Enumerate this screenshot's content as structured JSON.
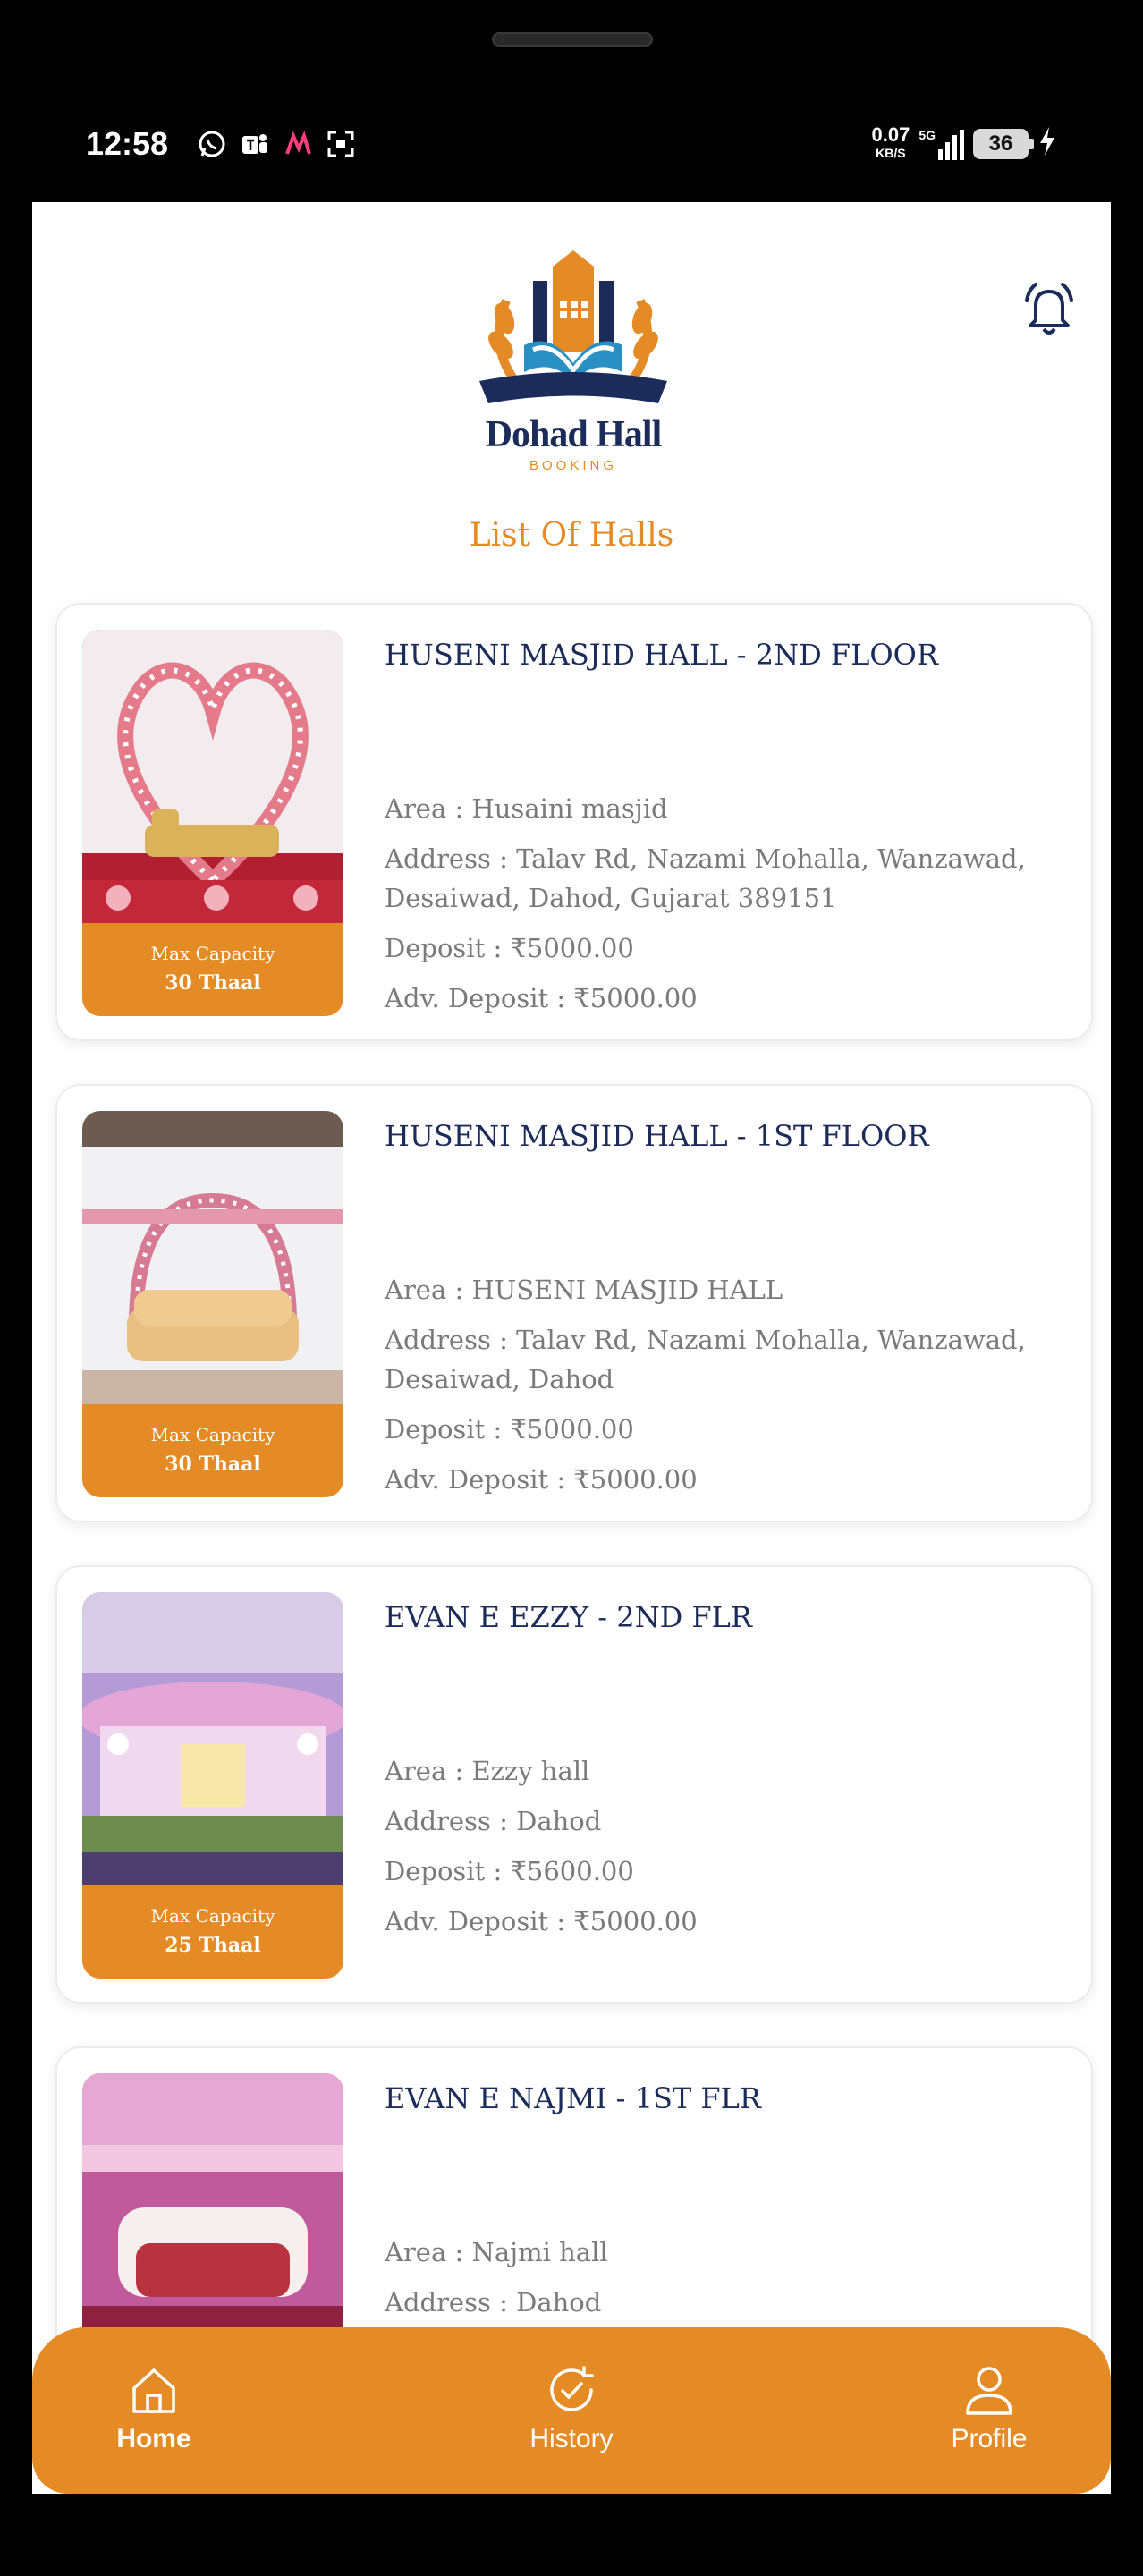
{
  "status_bar": {
    "time": "12:58",
    "net_speed": "0.07",
    "net_unit": "KB/S",
    "signal": "5G",
    "battery": "36"
  },
  "header": {
    "logo_text": "Dohad Hall",
    "logo_sub": "BOOKING",
    "page_title": "List Of Halls"
  },
  "halls": [
    {
      "name": "HUSENI MASJID HALL - 2ND FLOOR",
      "area": "Area : Husaini masjid",
      "address": "Address : Talav Rd, Nazami Mohalla, Wanzawad, Desaiwad, Dahod, Gujarat 389151",
      "deposit": "Deposit : ₹5000.00",
      "adv_deposit": "Adv. Deposit : ₹5000.00",
      "capacity_label": "Max Capacity",
      "capacity_value": "30 Thaal"
    },
    {
      "name": "HUSENI MASJID HALL - 1ST FLOOR",
      "area": "Area : HUSENI MASJID HALL",
      "address": "Address : Talav Rd, Nazami Mohalla, Wanzawad, Desaiwad, Dahod",
      "deposit": "Deposit : ₹5000.00",
      "adv_deposit": "Adv. Deposit : ₹5000.00",
      "capacity_label": "Max Capacity",
      "capacity_value": "30 Thaal"
    },
    {
      "name": "EVAN E EZZY - 2ND FLR",
      "area": "Area : Ezzy hall",
      "address": "Address : Dahod",
      "deposit": "Deposit : ₹5600.00",
      "adv_deposit": "Adv. Deposit : ₹5000.00",
      "capacity_label": "Max Capacity",
      "capacity_value": "25 Thaal"
    },
    {
      "name": "EVAN E NAJMI - 1ST FLR",
      "area": "Area : Najmi hall",
      "address": "Address : Dahod"
    }
  ],
  "bottom_nav": {
    "home": "Home",
    "history": "History",
    "profile": "Profile"
  },
  "colors": {
    "accent": "#e58b25",
    "navy": "#1b2b5a"
  }
}
